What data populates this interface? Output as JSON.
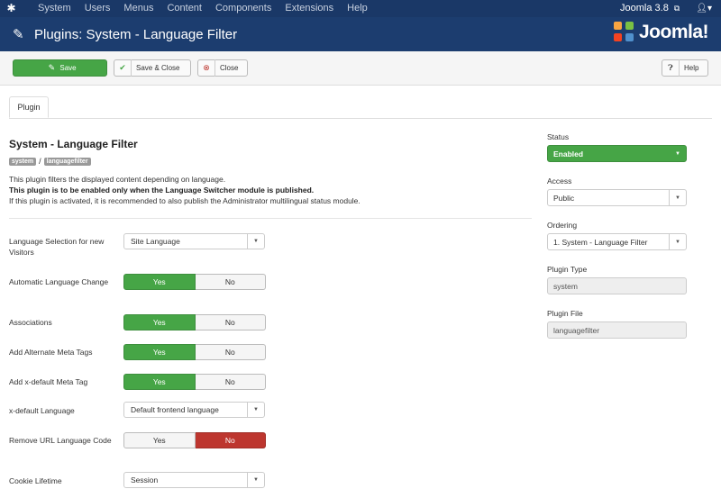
{
  "topnav": {
    "menu": [
      "System",
      "Users",
      "Menus",
      "Content",
      "Components",
      "Extensions",
      "Help"
    ],
    "version": "Joomla 3.8",
    "external_icon": "external-link-icon",
    "user_icon": "user-icon"
  },
  "header": {
    "title": "Plugins: System - Language Filter",
    "brand": "Joomla!",
    "icon": "plug-icon"
  },
  "toolbar": {
    "save": "Save",
    "save_close": "Save & Close",
    "close": "Close",
    "help": "Help"
  },
  "tabs": [
    "Plugin"
  ],
  "plugin": {
    "title": "System - Language Filter",
    "badge_folder": "system",
    "badge_sep": "/",
    "badge_element": "languagefilter",
    "desc1": "This plugin filters the displayed content depending on language.",
    "desc2": "This plugin is to be enabled only when the Language Switcher module is published.",
    "desc3": "If this plugin is activated, it is recommended to also publish the Administrator multilingual status module."
  },
  "fields": {
    "lang_selection": {
      "label": "Language Selection for new Visitors",
      "value": "Site Language"
    },
    "auto_change": {
      "label": "Automatic Language Change",
      "yes": "Yes",
      "no": "No",
      "selected": "Yes"
    },
    "associations": {
      "label": "Associations",
      "yes": "Yes",
      "no": "No",
      "selected": "Yes"
    },
    "alt_meta": {
      "label": "Add Alternate Meta Tags",
      "yes": "Yes",
      "no": "No",
      "selected": "Yes"
    },
    "xdefault_tag": {
      "label": "Add x-default Meta Tag",
      "yes": "Yes",
      "no": "No",
      "selected": "Yes"
    },
    "xdefault_lang": {
      "label": "x-default Language",
      "value": "Default frontend language"
    },
    "remove_url_code": {
      "label": "Remove URL Language Code",
      "yes": "Yes",
      "no": "No",
      "selected": "No"
    },
    "cookie": {
      "label": "Cookie Lifetime",
      "value": "Session"
    }
  },
  "sidebar": {
    "status_label": "Status",
    "status_value": "Enabled",
    "access_label": "Access",
    "access_value": "Public",
    "ordering_label": "Ordering",
    "ordering_value": "1. System - Language Filter",
    "type_label": "Plugin Type",
    "type_value": "system",
    "file_label": "Plugin File",
    "file_value": "languagefilter"
  },
  "colors": {
    "navbar": "#1a3867",
    "header": "#1c3d6f",
    "success": "#46a546",
    "danger": "#bd362f"
  }
}
